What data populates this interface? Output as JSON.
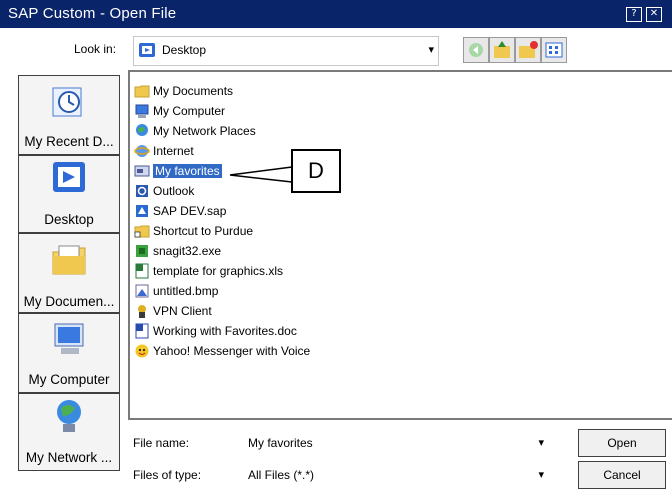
{
  "window": {
    "title": "SAP Custom - Open File",
    "help_btn": "?",
    "close_btn": "✕"
  },
  "lookin": {
    "label": "Look in:",
    "value": "Desktop"
  },
  "places": [
    {
      "label": "My Recent D..."
    },
    {
      "label": "Desktop"
    },
    {
      "label": "My Documen..."
    },
    {
      "label": "My Computer"
    },
    {
      "label": "My Network ..."
    }
  ],
  "files": [
    {
      "name": "My Documents"
    },
    {
      "name": "My Computer"
    },
    {
      "name": "My Network Places"
    },
    {
      "name": "Internet"
    },
    {
      "name": "My favorites"
    },
    {
      "name": "Outlook"
    },
    {
      "name": "SAP DEV.sap"
    },
    {
      "name": "Shortcut to Purdue"
    },
    {
      "name": "snagit32.exe"
    },
    {
      "name": "template for graphics.xls"
    },
    {
      "name": "untitled.bmp"
    },
    {
      "name": "VPN Client"
    },
    {
      "name": "Working with Favorites.doc"
    },
    {
      "name": "Yahoo! Messenger with Voice"
    }
  ],
  "filename": {
    "label": "File name:",
    "value": "My favorites"
  },
  "filetype": {
    "label": "Files of type:",
    "value": "All Files (*.*)"
  },
  "buttons": {
    "open": "Open",
    "cancel": "Cancel"
  },
  "callout": {
    "text": "D"
  },
  "colors": {
    "titlebar": "#0a246a",
    "selection": "#316ac5"
  }
}
